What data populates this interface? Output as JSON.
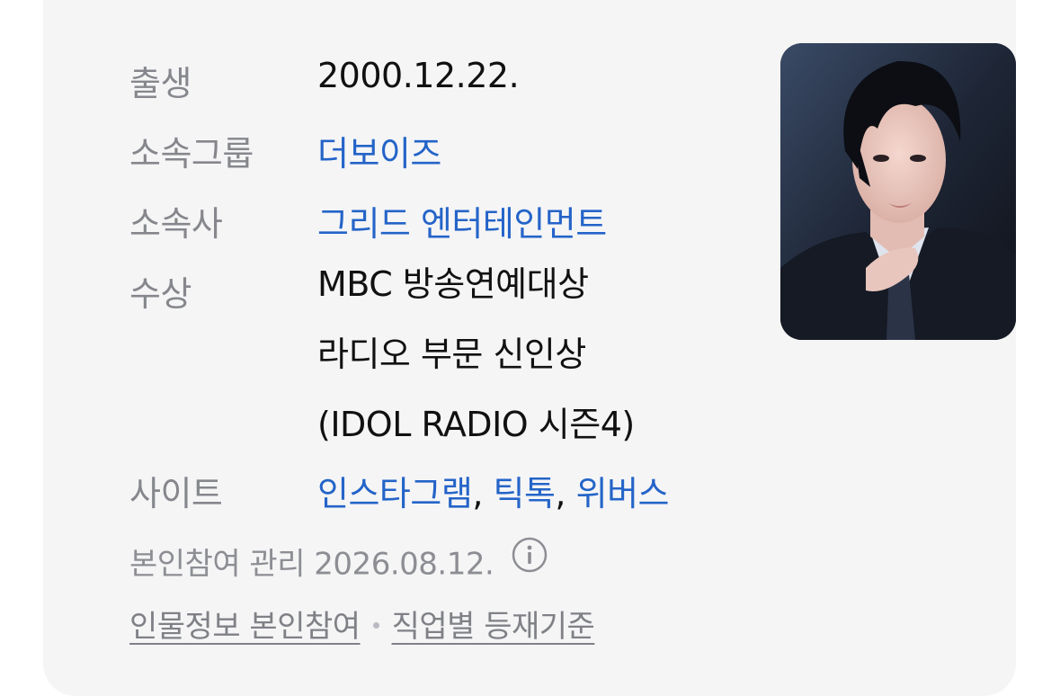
{
  "profile": {
    "birth": {
      "label": "출생",
      "value": "2000.12.22."
    },
    "group": {
      "label": "소속그룹",
      "value": "더보이즈"
    },
    "agency": {
      "label": "소속사",
      "value": "그리드 엔터테인먼트"
    },
    "awards": {
      "label": "수상",
      "lines": [
        "MBC 방송연예대상",
        "라디오 부문 신인상",
        "(IDOL RADIO 시즌4)"
      ]
    },
    "sites": {
      "label": "사이트",
      "links": [
        "인스타그램",
        "틱톡",
        "위버스"
      ],
      "separator": ","
    }
  },
  "photo": {
    "icon": "person-portrait-photo"
  },
  "footer": {
    "managed": "본인참여 관리 2026.08.12.",
    "info_icon": "info-circle-icon",
    "link_profile": "인물정보 본인참여",
    "link_criteria": "직업별 등재기준"
  },
  "colors": {
    "card_bg": "#f5f5f6",
    "label": "#85878c",
    "value": "#111111",
    "link": "#2464c8",
    "footer": "#8c8e93"
  }
}
